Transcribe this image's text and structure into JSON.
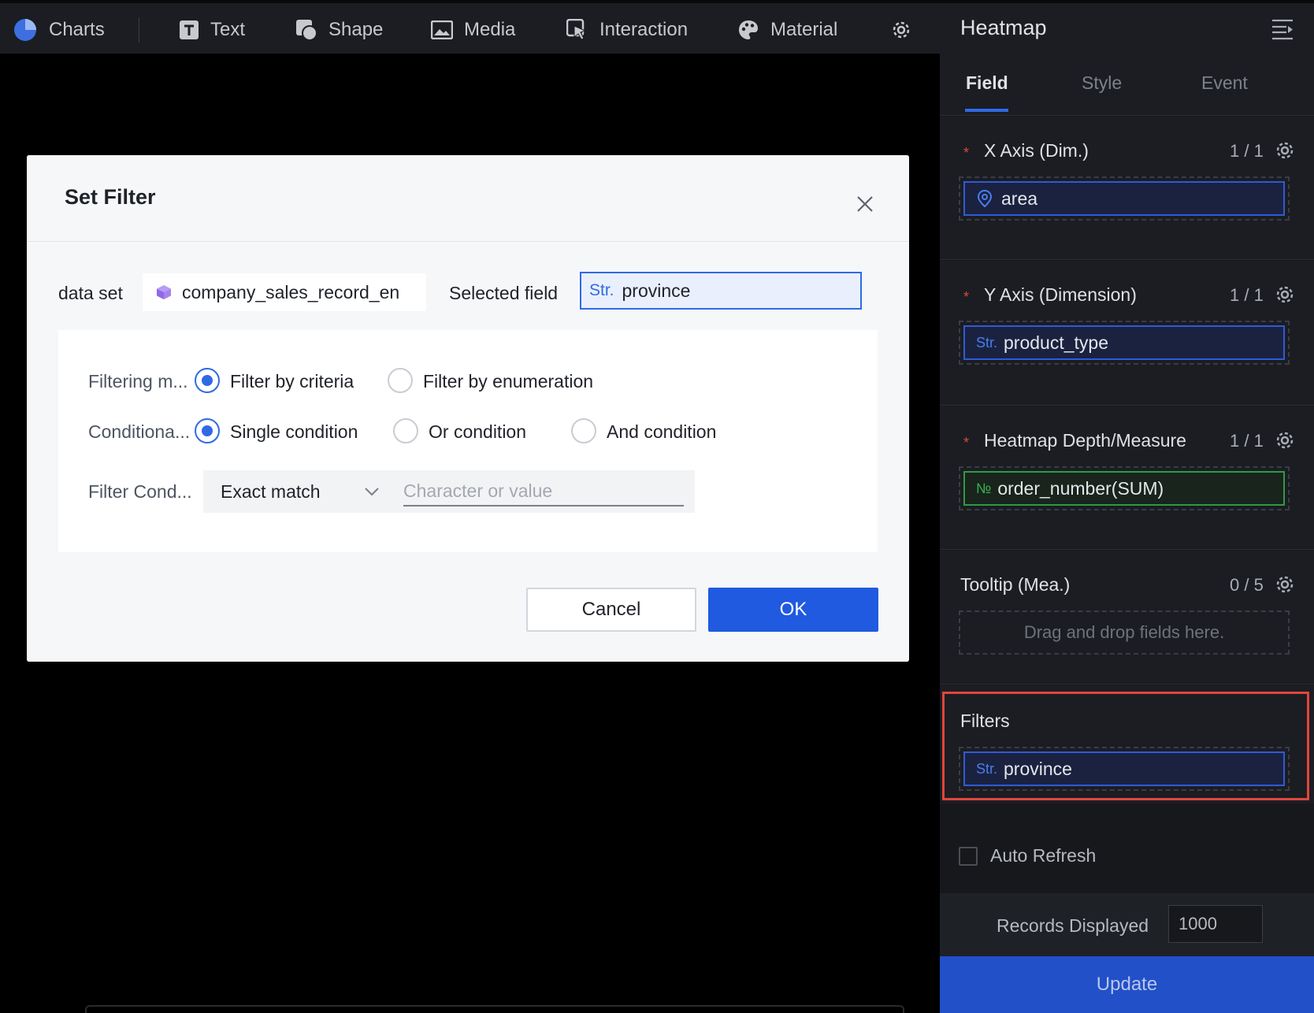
{
  "toolbar": {
    "items": [
      {
        "label": "Charts",
        "icon": "pie-chart-icon"
      },
      {
        "label": "Text",
        "icon": "text-icon"
      },
      {
        "label": "Shape",
        "icon": "shape-icon"
      },
      {
        "label": "Media",
        "icon": "image-icon"
      },
      {
        "label": "Interaction",
        "icon": "pointer-icon"
      },
      {
        "label": "Material",
        "icon": "palette-icon"
      }
    ],
    "settings_icon": "gear-icon"
  },
  "modal": {
    "title": "Set Filter",
    "dataset_label": "data set",
    "dataset_value": "company_sales_record_en",
    "selected_field_label": "Selected field",
    "selected_field_type": "Str.",
    "selected_field_value": "province",
    "filtering_mode_label": "Filtering m...",
    "filtering_mode_options": [
      "Filter by criteria",
      "Filter by enumeration"
    ],
    "filtering_mode_selected": "Filter by criteria",
    "conditional_label": "Conditiona...",
    "conditional_options": [
      "Single condition",
      "Or condition",
      "And condition"
    ],
    "conditional_selected": "Single condition",
    "filter_condition_label": "Filter Cond...",
    "match_type": "Exact match",
    "value_placeholder": "Character or value",
    "cancel_label": "Cancel",
    "ok_label": "OK"
  },
  "panel": {
    "title": "Heatmap",
    "tabs": [
      "Field",
      "Style",
      "Event"
    ],
    "active_tab": "Field",
    "sections": [
      {
        "title": "X Axis (Dim.)",
        "required": true,
        "count": "1 / 1",
        "field": {
          "type": "location",
          "name": "area"
        }
      },
      {
        "title": "Y Axis (Dimension)",
        "required": true,
        "count": "1 / 1",
        "field": {
          "type": "Str.",
          "name": "product_type"
        }
      },
      {
        "title": "Heatmap Depth/Measure",
        "required": true,
        "count": "1 / 1",
        "field": {
          "type": "№",
          "name": "order_number(SUM)"
        }
      },
      {
        "title": "Tooltip (Mea.)",
        "required": false,
        "count": "0 / 5",
        "placeholder": "Drag and drop fields here."
      }
    ],
    "filters": {
      "title": "Filters",
      "field": {
        "type": "Str.",
        "name": "province"
      }
    },
    "auto_refresh_label": "Auto Refresh",
    "auto_refresh_checked": false,
    "records_label": "Records Displayed",
    "records_value": "1000",
    "update_label": "Update"
  },
  "colors": {
    "accent": "#2f6ae6",
    "ok_button": "#1f5ae0",
    "highlight": "#e0463c",
    "measure_green": "#2f9a45"
  }
}
